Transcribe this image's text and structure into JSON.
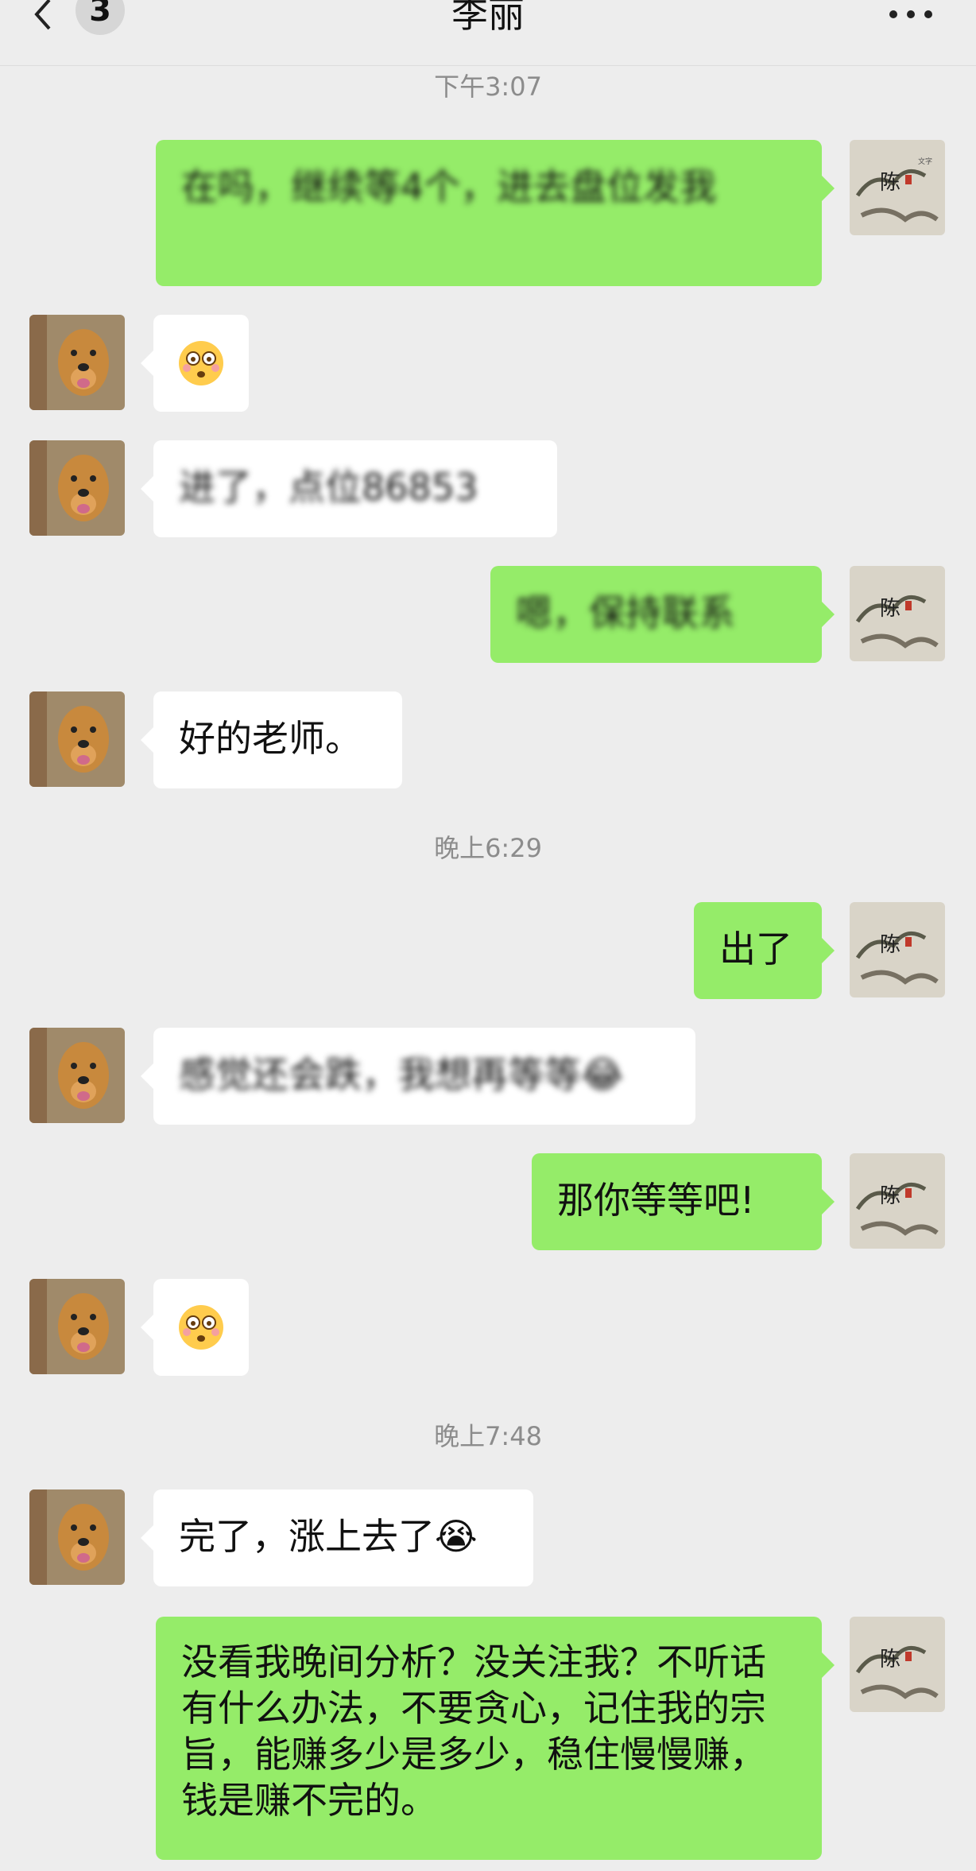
{
  "header": {
    "title": "李丽",
    "unread_count": "3",
    "back_icon": "chevron-left-icon",
    "more_icon": "more-horizontal-icon"
  },
  "messages": [
    {
      "type": "time",
      "text": "下午3:07"
    },
    {
      "type": "out",
      "text": "在吗，继续等4个，进去盘位发我"
    },
    {
      "type": "in",
      "text": "😳"
    },
    {
      "type": "in",
      "text": "进了，点位86853"
    },
    {
      "type": "out",
      "text": "嗯，保持联系"
    },
    {
      "type": "in",
      "text": "好的老师。"
    },
    {
      "type": "time",
      "text": "晚上6:29"
    },
    {
      "type": "out",
      "text": "出了"
    },
    {
      "type": "in",
      "text": "感觉还会跌，我想再等等😂"
    },
    {
      "type": "out",
      "text": "那你等等吧!"
    },
    {
      "type": "in",
      "text": "😳"
    },
    {
      "type": "time",
      "text": "晚上7:48"
    },
    {
      "type": "in",
      "text": "完了，涨上去了😭"
    },
    {
      "type": "out",
      "text": "没看我晚间分析？没关注我？不听话有什么办法，不要贪心，记住我的宗旨，能赚多少是多少，稳住慢慢赚，钱是赚不完的。"
    }
  ],
  "avatars": {
    "contact": "dog-avatar",
    "self": "ink-painting-avatar"
  }
}
